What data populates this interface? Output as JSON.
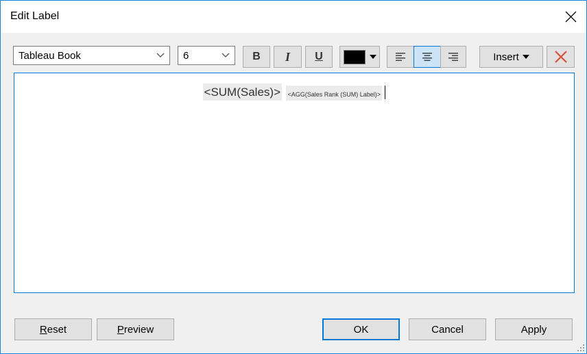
{
  "window": {
    "title": "Edit Label",
    "close_icon": "close-x-icon"
  },
  "toolbar": {
    "font_family": "Tableau Book",
    "font_size": "6",
    "bold_label": "B",
    "italic_label": "I",
    "underline_label": "U",
    "font_color": "#000000",
    "alignment": "center",
    "align_left_icon": "align-left-icon",
    "align_center_icon": "align-center-icon",
    "align_right_icon": "align-right-icon",
    "insert_label": "Insert",
    "clear_icon": "clear-x-icon",
    "accent_color": "#0078d7",
    "clear_color": "#d9513a"
  },
  "editor": {
    "fields": [
      {
        "text": "<SUM(Sales)>",
        "size": "large"
      },
      {
        "text": "<AGG(Sales Rank (SUM) Label)>",
        "size": "small"
      }
    ]
  },
  "buttons": {
    "reset_mnemonic": "R",
    "reset_rest": "eset",
    "preview_mnemonic": "P",
    "preview_rest": "review",
    "ok": "OK",
    "cancel": "Cancel",
    "apply": "Apply"
  }
}
